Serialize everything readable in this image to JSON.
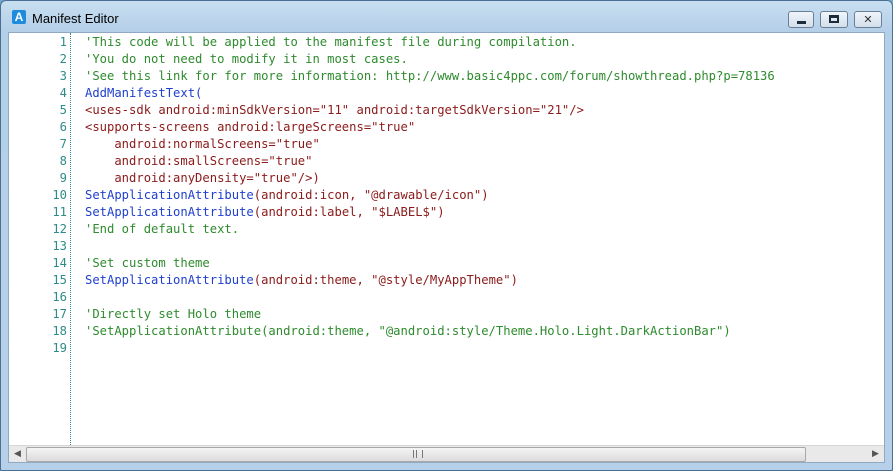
{
  "window": {
    "title": "Manifest Editor",
    "icon_letter": "A"
  },
  "controls": {
    "close_glyph": "✕"
  },
  "editor": {
    "lines": [
      {
        "n": "1",
        "segments": [
          {
            "t": "'This code will be applied to the manifest file during compilation.",
            "k": "comment"
          }
        ]
      },
      {
        "n": "2",
        "segments": [
          {
            "t": "'You do not need to modify it in most cases.",
            "k": "comment"
          }
        ]
      },
      {
        "n": "3",
        "segments": [
          {
            "t": "'See this link for for more information: http://www.basic4ppc.com/forum/showthread.php?p=78136",
            "k": "comment"
          }
        ]
      },
      {
        "n": "4",
        "segments": [
          {
            "t": "AddManifestText(",
            "k": "func"
          }
        ]
      },
      {
        "n": "5",
        "segments": [
          {
            "t": "<uses-sdk android:minSdkVersion=\"11\" android:targetSdkVersion=\"21\"/>",
            "k": "attr"
          }
        ]
      },
      {
        "n": "6",
        "segments": [
          {
            "t": "<supports-screens android:largeScreens=\"true\"",
            "k": "attr"
          }
        ]
      },
      {
        "n": "7",
        "segments": [
          {
            "t": "    android:normalScreens=\"true\"",
            "k": "attr"
          }
        ]
      },
      {
        "n": "8",
        "segments": [
          {
            "t": "    android:smallScreens=\"true\"",
            "k": "attr"
          }
        ]
      },
      {
        "n": "9",
        "segments": [
          {
            "t": "    android:anyDensity=\"true\"/>)",
            "k": "attr"
          }
        ]
      },
      {
        "n": "10",
        "segments": [
          {
            "t": "SetApplicationAttribute",
            "k": "func"
          },
          {
            "t": "(android:icon, \"@drawable/icon\")",
            "k": "attr"
          }
        ]
      },
      {
        "n": "11",
        "segments": [
          {
            "t": "SetApplicationAttribute",
            "k": "func"
          },
          {
            "t": "(android:label, \"$LABEL$\")",
            "k": "attr"
          }
        ]
      },
      {
        "n": "12",
        "segments": [
          {
            "t": "'End of default text.",
            "k": "comment"
          }
        ]
      },
      {
        "n": "13",
        "segments": []
      },
      {
        "n": "14",
        "segments": [
          {
            "t": "'Set custom theme",
            "k": "comment"
          }
        ]
      },
      {
        "n": "15",
        "segments": [
          {
            "t": "SetApplicationAttribute",
            "k": "func"
          },
          {
            "t": "(android:theme, \"@style/MyAppTheme\")",
            "k": "attr"
          }
        ]
      },
      {
        "n": "16",
        "segments": []
      },
      {
        "n": "17",
        "segments": [
          {
            "t": "'Directly set Holo theme",
            "k": "comment"
          }
        ]
      },
      {
        "n": "18",
        "segments": [
          {
            "t": "'SetApplicationAttribute(android:theme, \"@android:style/Theme.Holo.Light.DarkActionBar\")",
            "k": "comment"
          }
        ]
      },
      {
        "n": "19",
        "segments": []
      }
    ]
  },
  "scrollbar": {
    "left_glyph": "◀",
    "right_glyph": "▶"
  },
  "colors": {
    "comment": "#2e8b2e",
    "function": "#1f3fcf",
    "attribute": "#8b1a1a",
    "line_number": "#2e8b8b"
  }
}
